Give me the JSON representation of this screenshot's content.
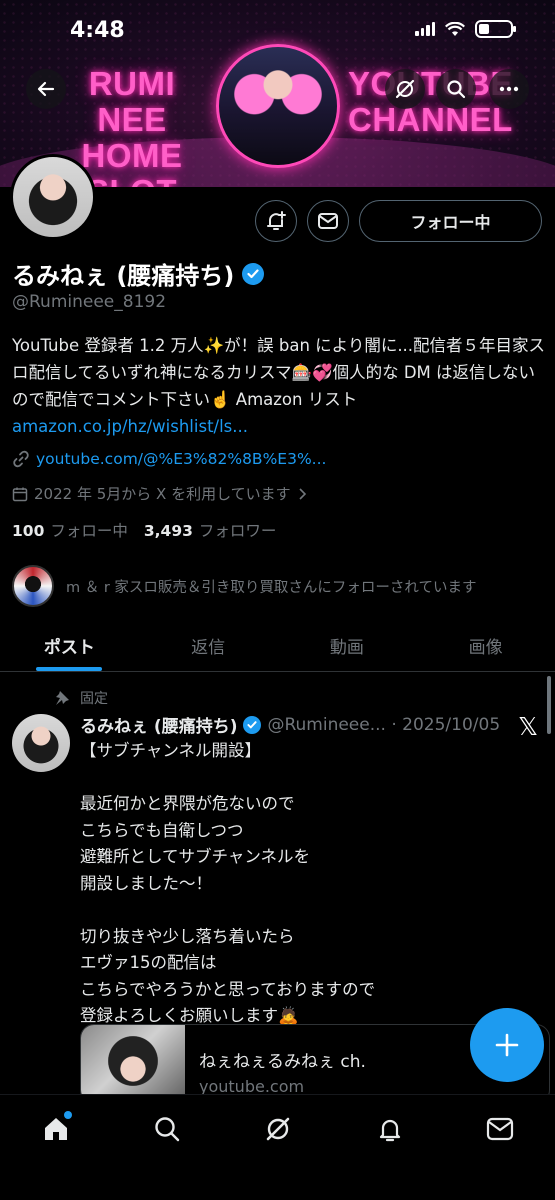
{
  "status_bar": {
    "time": "4:48"
  },
  "banner": {
    "left_text": "RUMI NEE\nHOME SLOT",
    "right_text": "YOUTUBE\nCHANNEL"
  },
  "profile": {
    "display_name": "るみねぇ (腰痛持ち)",
    "handle": "@Rumineee_8192",
    "follow_label": "フォロー中",
    "bio_text": "YouTube 登録者 1.2 万人✨が！誤 ban により闇に...配信者５年目家スロ配信してるいずれ神になるカリスマ🎰💞個人的な DM は返信しないので配信でコメント下さい☝️ Amazon リスト ",
    "bio_link": "amazon.co.jp/hz/wishlist/ls...",
    "website": "youtube.com/@%E3%82%8B%E3%...",
    "joined": "2022 年 5月から X を利用しています",
    "following_count": "100",
    "following_label": "フォロー中",
    "followers_count": "3,493",
    "followers_label": "フォロワー",
    "followed_by": "m ＆ r 家スロ販売＆引き取り買取さんにフォローされています"
  },
  "tabs": [
    "ポスト",
    "返信",
    "動画",
    "画像"
  ],
  "active_tab": 0,
  "post": {
    "pinned_label": "固定",
    "author": "るみねぇ (腰痛持ち)",
    "meta": "@Rumineee... · 2025/10/05",
    "body": "【サブチャンネル開設】\n\n最近何かと界隈が危ないので\nこちらでも自衛しつつ\n避難所としてサブチャンネルを\n開設しました〜！\n\n切り抜きや少し落ち着いたら\nエヴァ15の配信は\nこちらでやろうかと思っておりますので\n登録よろしくお願いします🙇",
    "card_title": "ねぇねぇるみねぇ ch.",
    "card_domain": "youtube.com"
  },
  "icons": {
    "back": "back-arrow-icon",
    "grok": "grok-icon",
    "search": "search-icon",
    "more": "more-icon",
    "notify": "add-notification-icon",
    "message": "message-icon",
    "link": "link-icon",
    "calendar": "calendar-icon",
    "pin": "pin-icon",
    "x": "x-logo-icon",
    "compose": "plus-icon",
    "nav": [
      "home-icon",
      "search-icon",
      "grok-icon",
      "bell-icon",
      "mail-icon"
    ]
  },
  "colors": {
    "accent": "#1d9bf0",
    "background": "#000000",
    "muted": "#71767b",
    "neon": "#ff5fc8"
  }
}
